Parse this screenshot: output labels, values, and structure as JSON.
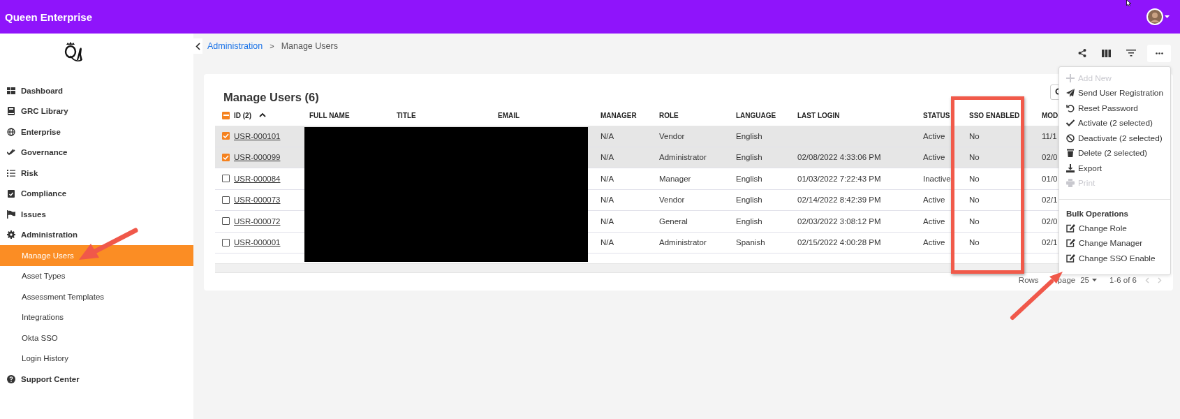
{
  "header": {
    "title": "Queen Enterprise"
  },
  "sidebar": {
    "items": [
      {
        "label": "Dashboard",
        "selected": false
      },
      {
        "label": "GRC Library",
        "selected": false
      },
      {
        "label": "Enterprise",
        "selected": false
      },
      {
        "label": "Governance",
        "selected": false
      },
      {
        "label": "Risk",
        "selected": false
      },
      {
        "label": "Compliance",
        "selected": false
      },
      {
        "label": "Issues",
        "selected": false
      },
      {
        "label": "Administration",
        "selected": false,
        "children": [
          {
            "label": "Manage Users",
            "selected": true
          },
          {
            "label": "Asset Types",
            "selected": false
          },
          {
            "label": "Assessment Templates",
            "selected": false
          },
          {
            "label": "Integrations",
            "selected": false
          },
          {
            "label": "Okta SSO",
            "selected": false
          },
          {
            "label": "Login History",
            "selected": false
          }
        ]
      },
      {
        "label": "Support Center",
        "selected": false
      }
    ]
  },
  "breadcrumb": {
    "parent": "Administration",
    "separator": ">",
    "current": "Manage Users"
  },
  "card": {
    "title": "Manage Users (6)",
    "select_all_partial": true,
    "columns": [
      {
        "label": "ID (2)",
        "sorted_ascending": true
      },
      {
        "label": "FULL NAME"
      },
      {
        "label": "TITLE"
      },
      {
        "label": "EMAIL"
      },
      {
        "label": "MANAGER"
      },
      {
        "label": "ROLE"
      },
      {
        "label": "LANGUAGE"
      },
      {
        "label": "LAST LOGIN"
      },
      {
        "label": "STATUS"
      },
      {
        "label": "SSO ENABLED"
      },
      {
        "label": "MOD"
      }
    ],
    "rows": [
      {
        "id": "USR-000101",
        "selected": true,
        "manager": "N/A",
        "role": "Vendor",
        "language": "English",
        "status": "Active",
        "sso_enabled": "No",
        "modified": "11/1"
      },
      {
        "id": "USR-000099",
        "selected": true,
        "manager": "N/A",
        "role": "Administrator",
        "language": "English",
        "last_login": "02/08/2022 4:33:06 PM",
        "status": "Active",
        "sso_enabled": "No",
        "modified": "02/0"
      },
      {
        "id": "USR-000084",
        "selected": false,
        "manager": "N/A",
        "role": "Manager",
        "language": "English",
        "last_login": "01/03/2022 7:22:43 PM",
        "status": "Inactive",
        "sso_enabled": "No",
        "modified": "01/0"
      },
      {
        "id": "USR-000073",
        "selected": false,
        "manager": "N/A",
        "role": "Vendor",
        "language": "English",
        "last_login": "02/14/2022 8:42:39 PM",
        "status": "Active",
        "sso_enabled": "No",
        "modified": "02/1"
      },
      {
        "id": "USR-000072",
        "selected": false,
        "manager": "N/A",
        "role": "General",
        "language": "English",
        "last_login": "02/03/2022 3:08:12 PM",
        "status": "Active",
        "sso_enabled": "No",
        "modified": "02/0"
      },
      {
        "id": "USR-000001",
        "selected": false,
        "manager": "N/A",
        "role": "Administrator",
        "language": "Spanish",
        "last_login": "02/15/2022 4:00:28 PM",
        "status": "Active",
        "sso_enabled": "No",
        "modified": "02/1"
      }
    ],
    "pagination": {
      "label_start": "Rows",
      "label_end": "page",
      "page_size": "25",
      "range": "1-6 of 6"
    }
  },
  "menu": {
    "items": [
      {
        "label": "Add New",
        "disabled": true
      },
      {
        "label": "Send User Registration",
        "disabled": false
      },
      {
        "label": "Reset Password",
        "disabled": false
      },
      {
        "label": "Activate (2 selected)",
        "disabled": false
      },
      {
        "label": "Deactivate (2 selected)",
        "disabled": false
      },
      {
        "label": "Delete (2 selected)",
        "disabled": false
      },
      {
        "label": "Export",
        "disabled": false
      },
      {
        "label": "Print",
        "disabled": true
      }
    ],
    "section_title": "Bulk Operations",
    "bulk_items": [
      {
        "label": "Change Role",
        "disabled": false
      },
      {
        "label": "Change Manager",
        "disabled": false
      },
      {
        "label": "Change SSO Enable",
        "disabled": false
      }
    ]
  }
}
